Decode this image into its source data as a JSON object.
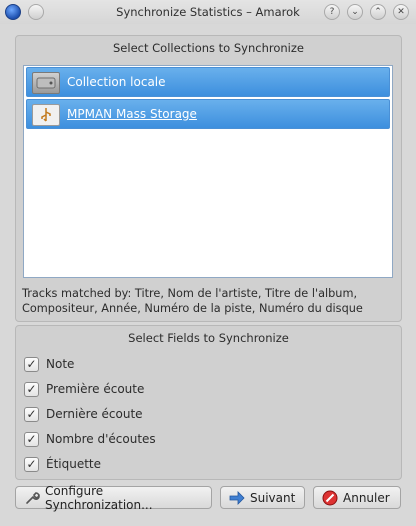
{
  "window": {
    "title": "Synchronize Statistics – Amarok",
    "controls": {
      "help": "?",
      "shade": "⌄",
      "maximize": "⌃",
      "close": "✕"
    }
  },
  "collections": {
    "heading": "Select Collections to Synchronize",
    "items": [
      {
        "label": "Collection locale",
        "icon": "hard-drive-icon",
        "selected": true
      },
      {
        "label": "MPMAN Mass Storage",
        "icon": "usb-icon",
        "selected": true
      }
    ],
    "tracks_matched": "Tracks matched by: Titre, Nom de l'artiste, Titre de l'album, Compositeur, Année, Numéro de la piste, Numéro du disque"
  },
  "fields": {
    "heading": "Select Fields to Synchronize",
    "items": [
      {
        "label": "Note",
        "checked": true
      },
      {
        "label": "Première écoute",
        "checked": true
      },
      {
        "label": "Dernière écoute",
        "checked": true
      },
      {
        "label": "Nombre d'écoutes",
        "checked": true
      },
      {
        "label": "Étiquette",
        "checked": true
      }
    ]
  },
  "buttons": {
    "configure": "Configure Synchronization...",
    "next": "Suivant",
    "cancel": "Annuler"
  },
  "colors": {
    "selection": "#4a9be6",
    "window_bg": "#d6d6d6"
  }
}
